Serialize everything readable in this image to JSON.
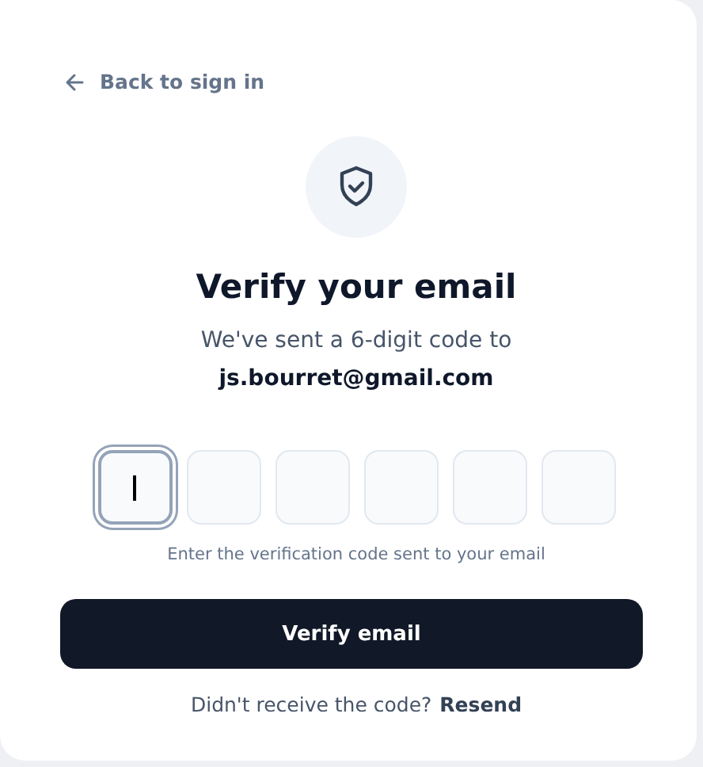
{
  "back_link": "Back to sign in",
  "title": "Verify your email",
  "subtitle": "We've sent a 6-digit code to",
  "email": "js.bourret@gmail.com",
  "code_digits": [
    {
      "selected": true
    },
    {
      "selected": false
    },
    {
      "selected": false
    },
    {
      "selected": false
    },
    {
      "selected": false
    },
    {
      "selected": false
    }
  ],
  "hint": "Enter the verification code sent to your email",
  "verify_button": "Verify email",
  "resend_prompt": "Didn't receive the code?",
  "resend_link": "Resend"
}
